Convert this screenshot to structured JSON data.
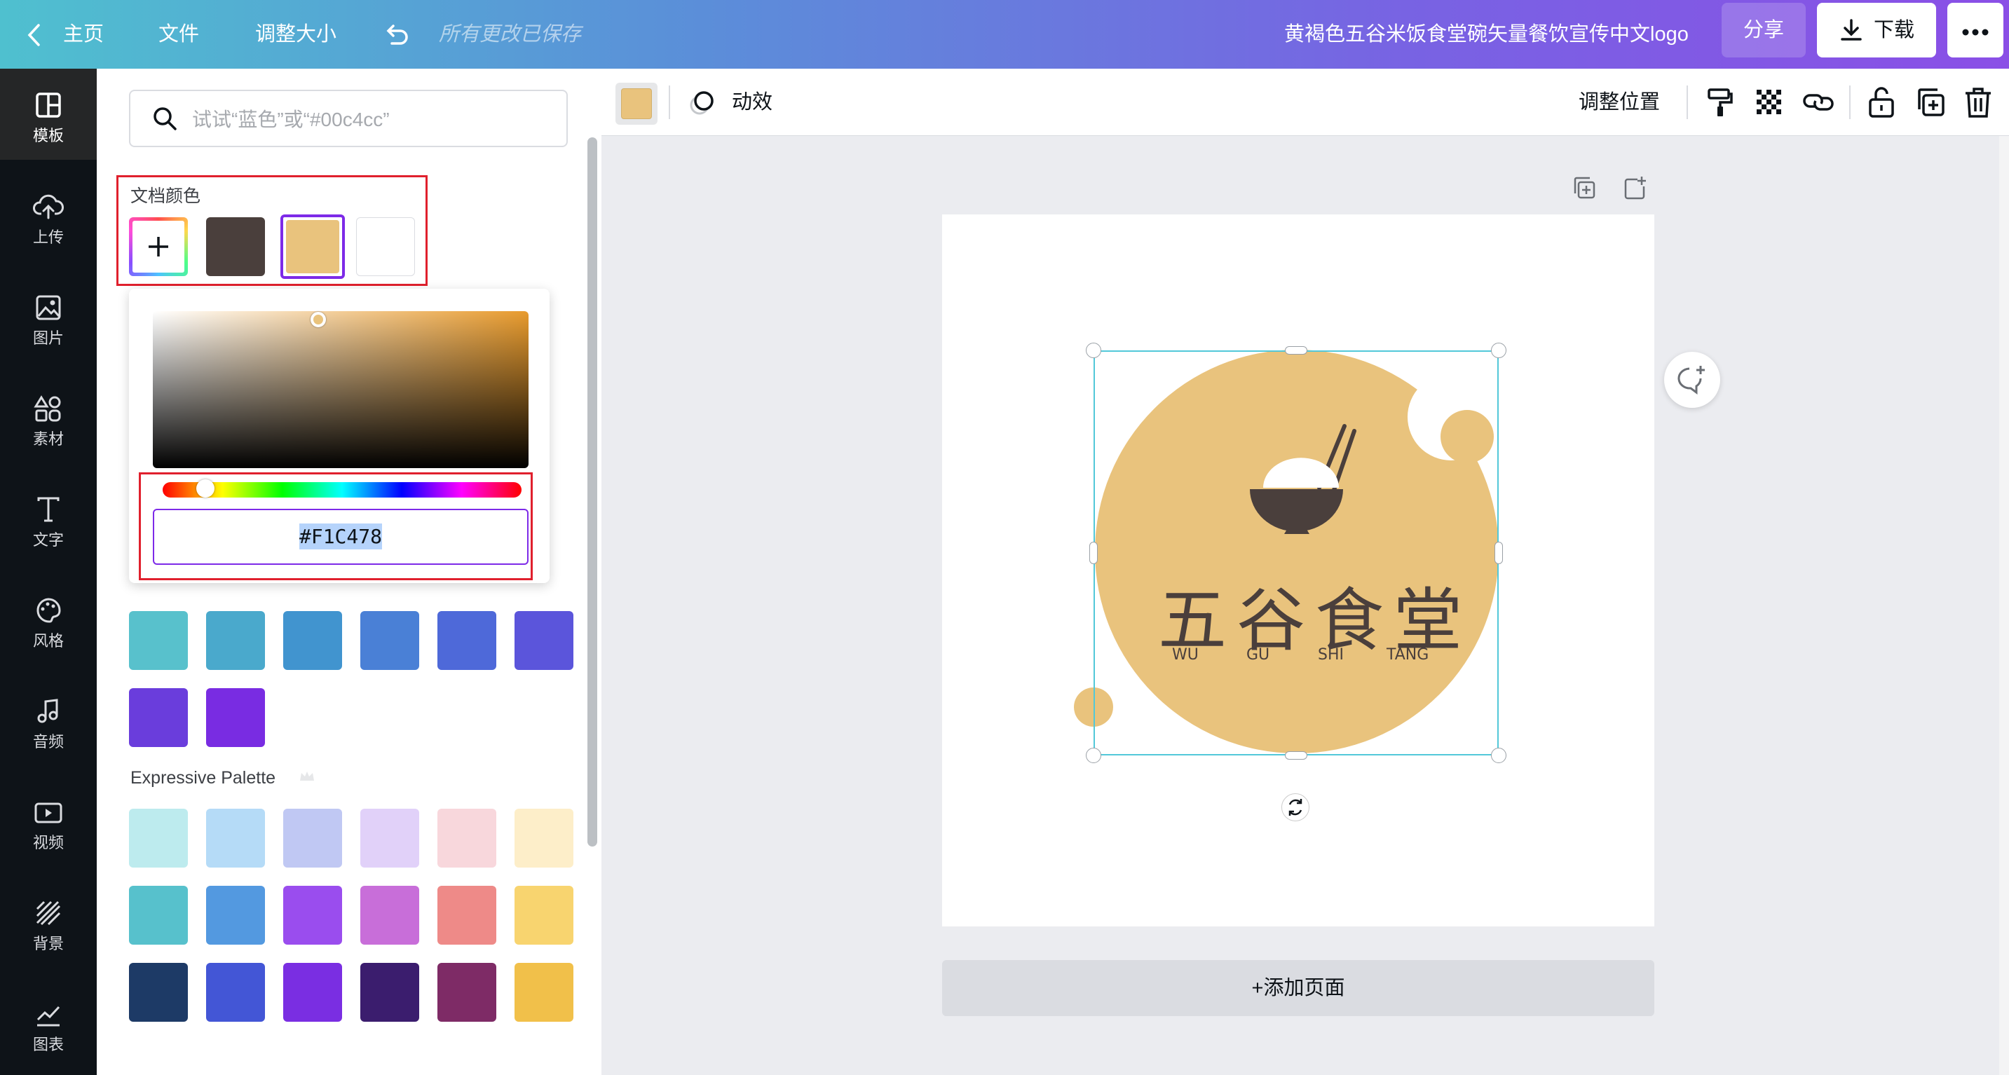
{
  "topbar": {
    "home": "主页",
    "file": "文件",
    "resize": "调整大小",
    "saved_status": "所有更改已保存",
    "doc_title": "黄褐色五谷米饭食堂碗矢量餐饮宣传中文logo",
    "share": "分享",
    "download": "下载"
  },
  "rail": {
    "items": [
      {
        "label": "模板",
        "icon": "template-icon"
      },
      {
        "label": "上传",
        "icon": "upload-icon"
      },
      {
        "label": "图片",
        "icon": "image-icon"
      },
      {
        "label": "素材",
        "icon": "elements-icon"
      },
      {
        "label": "文字",
        "icon": "text-icon"
      },
      {
        "label": "风格",
        "icon": "palette-icon"
      },
      {
        "label": "音频",
        "icon": "music-icon"
      },
      {
        "label": "视频",
        "icon": "video-icon"
      },
      {
        "label": "背景",
        "icon": "background-icon"
      },
      {
        "label": "图表",
        "icon": "chart-icon"
      }
    ]
  },
  "panel": {
    "search_placeholder": "试试“蓝色”或“#00c4cc”",
    "doc_colors_label": "文档颜色",
    "doc_colors": [
      "#4a3f3c",
      "#e9c37d",
      "#ffffff"
    ],
    "picker_hex": "#F1C478",
    "palette1": [
      "#58c1cc",
      "#4aa9cc",
      "#4194cf",
      "#4a80d6",
      "#4e69d9",
      "#5b55db",
      "#6a3ddc",
      "#792ce2"
    ],
    "expressive_label": "Expressive Palette",
    "expressive": [
      "#bdebee",
      "#b5dbf7",
      "#c0c8f3",
      "#e1d1f9",
      "#f8d7dc",
      "#fdeec9",
      "#57c1cc",
      "#5399e0",
      "#9a4dee",
      "#c86ed9",
      "#ee8a88",
      "#f8d46f",
      "#1d3a66",
      "#4356d6",
      "#7a2ee2",
      "#3b1d6e",
      "#7e2b66",
      "#f1c04a"
    ]
  },
  "toolbar": {
    "animate": "动效",
    "position": "调整位置",
    "selected_color": "#e9c37d"
  },
  "canvas": {
    "logo_cn": "五谷食堂",
    "logo_pinyin": [
      "WU",
      "GU",
      "SHI",
      "TANG"
    ],
    "add_page": "+添加页面"
  }
}
